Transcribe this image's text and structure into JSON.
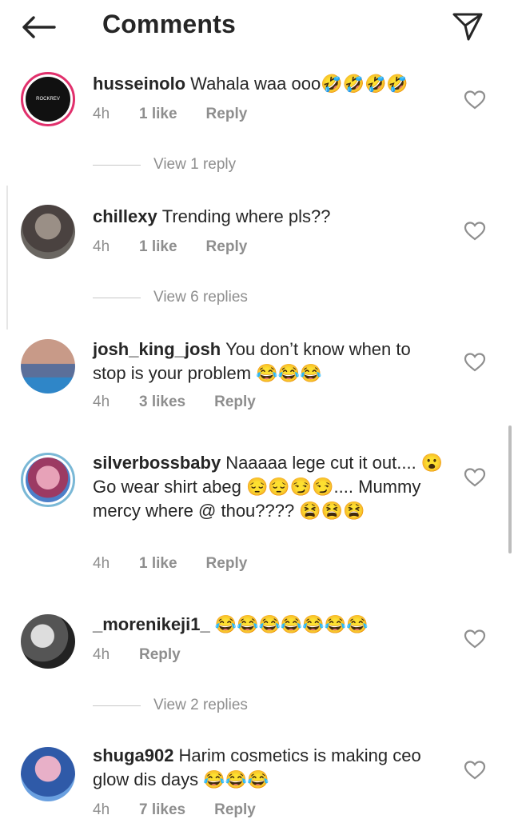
{
  "header": {
    "title": "Comments",
    "back_icon": "arrow-left-icon",
    "send_icon": "send-paper-plane-icon"
  },
  "comments": [
    {
      "user": "husseinolo",
      "text": "Wahala waa ooo🤣🤣🤣🤣",
      "time": "4h",
      "likes": "1 like",
      "reply": "Reply",
      "view_replies": "View 1 reply",
      "avatar_label": "ROCKREV"
    },
    {
      "user": "chillexy",
      "text": "Trending where pls??",
      "time": "4h",
      "likes": "1 like",
      "reply": "Reply",
      "view_replies": "View 6 replies"
    },
    {
      "user": "josh_king_josh",
      "text": "You don’t know when to stop is your problem 😂😂😂",
      "time": "4h",
      "likes": "3 likes",
      "reply": "Reply"
    },
    {
      "user": "silverbossbaby",
      "text": "Naaaaa lege cut it out.... 😮 Go wear shirt abeg 😔😔😏😏.... Mummy mercy where @ thou???? 😫😫😫",
      "time": "4h",
      "likes": "1 like",
      "reply": "Reply"
    },
    {
      "user": "_morenikeji1_",
      "text": "😂😂😂😂😂😂😂",
      "time": "4h",
      "likes": "",
      "reply": "Reply",
      "view_replies": "View 2 replies"
    },
    {
      "user": "shuga902",
      "text": "Harim cosmetics is making ceo glow dis days 😂😂😂",
      "time": "4h",
      "likes": "7 likes",
      "reply": "Reply"
    }
  ],
  "colors": {
    "text": "#262626",
    "secondary": "#8e8e8e",
    "story_ring": "#e1306c"
  }
}
